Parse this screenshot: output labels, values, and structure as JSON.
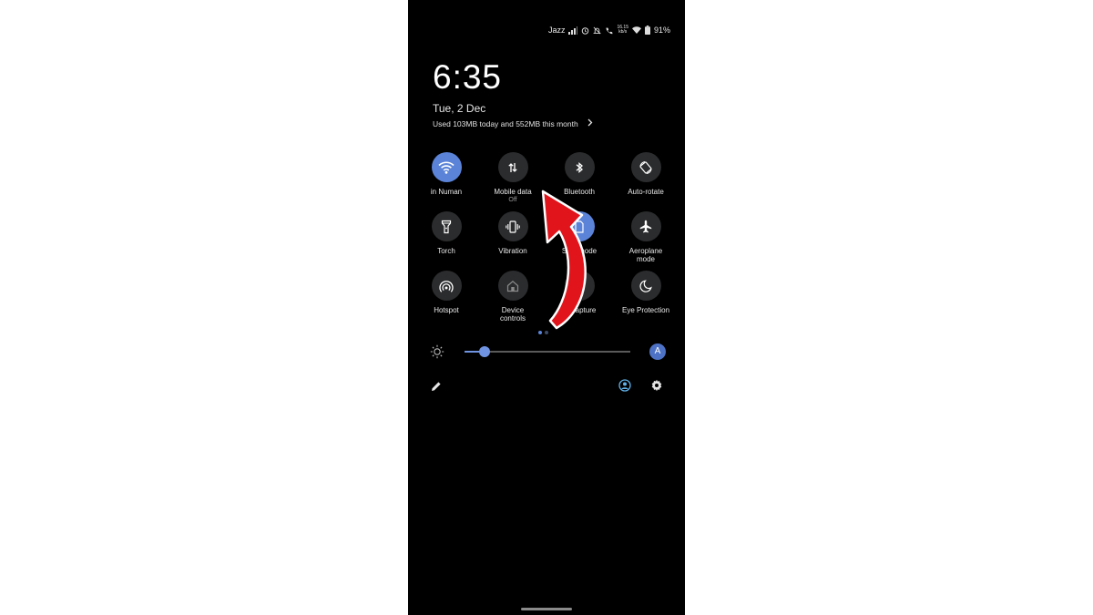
{
  "status": {
    "carrier": "Jazz",
    "speed_value": "16.15",
    "speed_unit": "kb/s",
    "battery": "91%"
  },
  "header": {
    "time": "6:35",
    "date": "Tue, 2 Dec",
    "usage": "Used 103MB today and 552MB this month"
  },
  "tiles": [
    {
      "label": "in Numan",
      "sub": "",
      "icon": "wifi-icon",
      "active": true
    },
    {
      "label": "Mobile data",
      "sub": "Off",
      "icon": "mobile-data-icon",
      "active": false
    },
    {
      "label": "Bluetooth",
      "sub": "",
      "icon": "bluetooth-icon",
      "active": false
    },
    {
      "label": "Auto-rotate",
      "sub": "",
      "icon": "auto-rotate-icon",
      "active": false
    },
    {
      "label": "Torch",
      "sub": "",
      "icon": "torch-icon",
      "active": false
    },
    {
      "label": "Vibration",
      "sub": "",
      "icon": "vibration-icon",
      "active": false
    },
    {
      "label": "Si      node",
      "sub": "",
      "icon": "sim-icon",
      "active": true
    },
    {
      "label": "Aeroplane",
      "sub": "mode",
      "icon": "aeroplane-icon",
      "active": false
    },
    {
      "label": "Hotspot",
      "sub": "",
      "icon": "hotspot-icon",
      "active": false
    },
    {
      "label": "Device",
      "sub": "controls",
      "icon": "device-controls-icon",
      "active": false
    },
    {
      "label": "apture",
      "sub": "",
      "icon": "capture-icon",
      "active": false
    },
    {
      "label": "Eye Protection",
      "sub": "",
      "icon": "eye-protection-icon",
      "active": false
    }
  ],
  "brightness": {
    "level": 0.12,
    "auto_label": "A"
  },
  "colors": {
    "accent": "#5b84d8",
    "tile": "#2b2c2e",
    "arrow": "#e1141c"
  },
  "page_indicator": {
    "pages": 2,
    "current": 1
  }
}
